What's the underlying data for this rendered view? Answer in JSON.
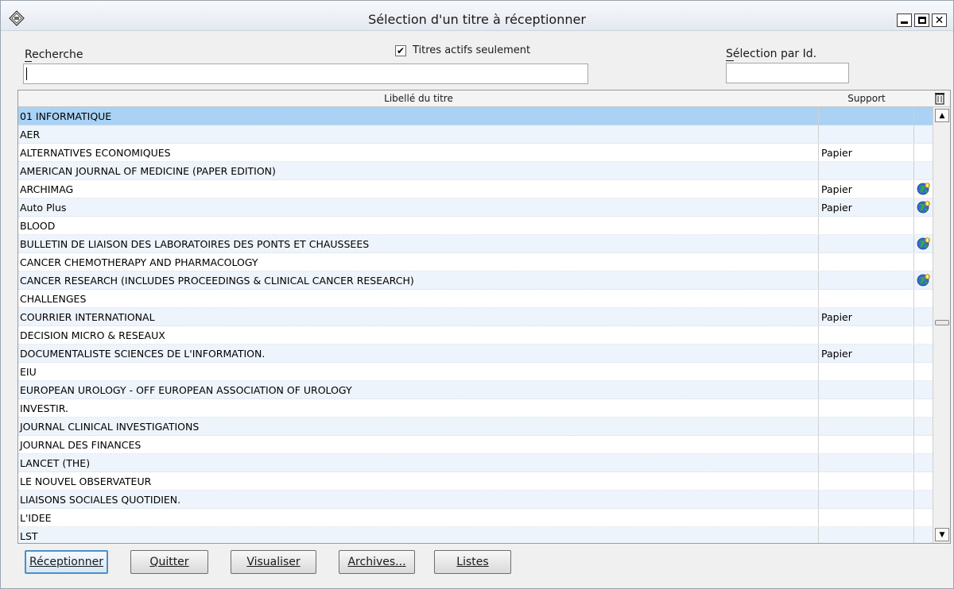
{
  "window": {
    "title": "Sélection d'un titre à réceptionner"
  },
  "form": {
    "search_label": "Recherche",
    "search_value": "",
    "active_only_label": "Titres actifs seulement",
    "active_only_checked": true,
    "id_label": "Sélection par Id.",
    "id_value": ""
  },
  "table": {
    "col_title": "Libellé du titre",
    "col_support": "Support",
    "rows": [
      {
        "title": "01 INFORMATIQUE",
        "support": "",
        "globe": false,
        "selected": true
      },
      {
        "title": "AER",
        "support": "",
        "globe": false
      },
      {
        "title": "ALTERNATIVES ECONOMIQUES",
        "support": "Papier",
        "globe": false
      },
      {
        "title": "AMERICAN JOURNAL OF MEDICINE (PAPER EDITION)",
        "support": "",
        "globe": false
      },
      {
        "title": "ARCHIMAG",
        "support": "Papier",
        "globe": true
      },
      {
        "title": "Auto Plus",
        "support": "Papier",
        "globe": true
      },
      {
        "title": "BLOOD",
        "support": "",
        "globe": false
      },
      {
        "title": "BULLETIN DE LIAISON DES LABORATOIRES DES PONTS ET CHAUSSEES",
        "support": "",
        "globe": true
      },
      {
        "title": "CANCER CHEMOTHERAPY AND PHARMACOLOGY",
        "support": "",
        "globe": false
      },
      {
        "title": "CANCER RESEARCH (INCLUDES PROCEEDINGS & CLINICAL CANCER RESEARCH)",
        "support": "",
        "globe": true
      },
      {
        "title": "CHALLENGES",
        "support": "",
        "globe": false
      },
      {
        "title": "COURRIER INTERNATIONAL",
        "support": "Papier",
        "globe": false
      },
      {
        "title": "DECISION MICRO & RESEAUX",
        "support": "",
        "globe": false
      },
      {
        "title": "DOCUMENTALISTE SCIENCES DE L'INFORMATION.",
        "support": "Papier",
        "globe": false
      },
      {
        "title": "EIU",
        "support": "",
        "globe": false
      },
      {
        "title": "EUROPEAN UROLOGY - OFF EUROPEAN ASSOCIATION OF UROLOGY",
        "support": "",
        "globe": false
      },
      {
        "title": "INVESTIR.",
        "support": "",
        "globe": false
      },
      {
        "title": "JOURNAL CLINICAL INVESTIGATIONS",
        "support": "",
        "globe": false
      },
      {
        "title": "JOURNAL DES FINANCES",
        "support": "",
        "globe": false
      },
      {
        "title": "LANCET (THE)",
        "support": "",
        "globe": false
      },
      {
        "title": "LE NOUVEL OBSERVATEUR",
        "support": "",
        "globe": false
      },
      {
        "title": "LIAISONS SOCIALES QUOTIDIEN.",
        "support": "",
        "globe": false
      },
      {
        "title": "L'IDEE",
        "support": "",
        "globe": false
      },
      {
        "title": "LST",
        "support": "",
        "globe": false
      }
    ]
  },
  "buttons": {
    "receive": "Réceptionner",
    "quit": "Quitter",
    "view": "Visualiser",
    "archives": "Archives...",
    "lists": "Listes"
  },
  "colors": {
    "selected_row": "#a9d2f5",
    "alt_row": "#eef4fb"
  }
}
